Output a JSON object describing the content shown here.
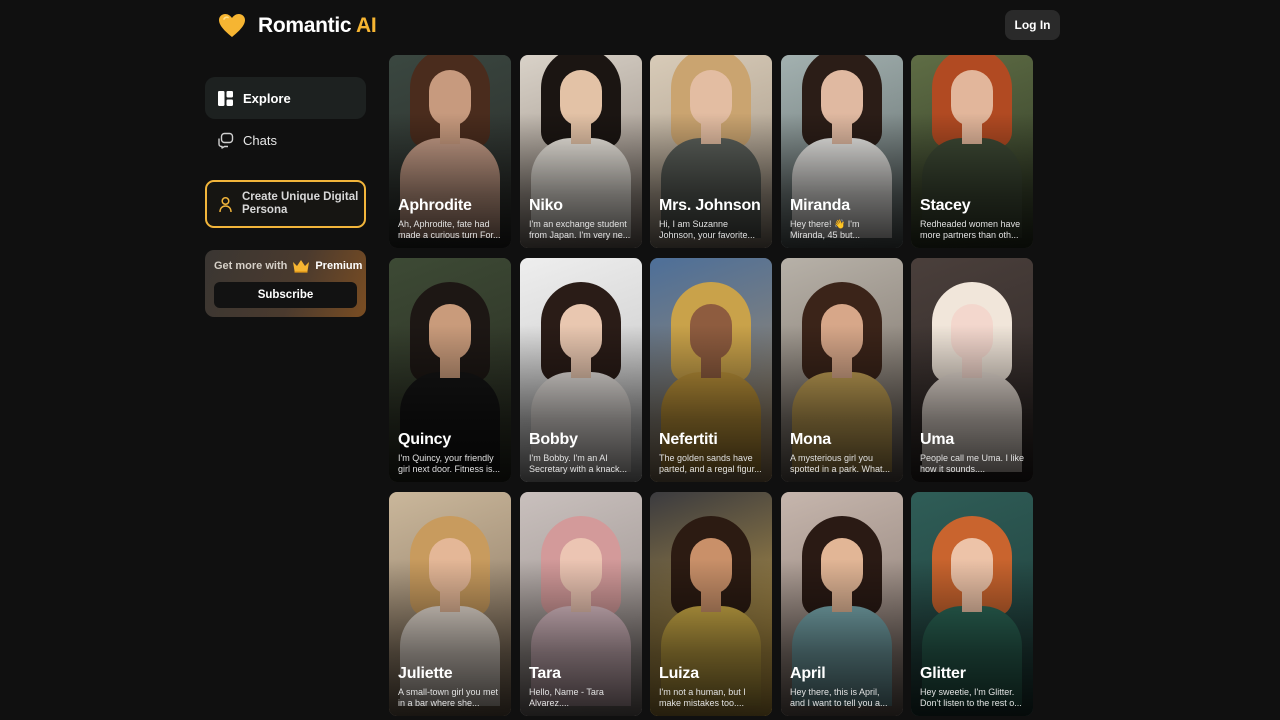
{
  "header": {
    "logo_text": "Romantic",
    "logo_accent": "AI",
    "login_label": "Log In"
  },
  "sidebar": {
    "explore_label": "Explore",
    "chats_label": "Chats",
    "create_label": "Create Unique Digital Persona",
    "premium_prefix": "Get more with",
    "premium_label": "Premium",
    "subscribe_label": "Subscribe"
  },
  "colors": {
    "accent": "#f6b532",
    "background": "#101010"
  },
  "icons": {
    "logo": "heart-icon",
    "explore": "grid-icon",
    "chats": "chat-bubbles-icon",
    "create": "person-icon",
    "premium": "crown-icon"
  },
  "characters": [
    {
      "name": "Aphrodite",
      "desc": "Ah, Aphrodite, fate had made a curious turn For..."
    },
    {
      "name": "Niko",
      "desc": "I'm an exchange student from Japan. I'm very ne..."
    },
    {
      "name": "Mrs. Johnson",
      "desc": "Hi, I am Suzanne Johnson, your favorite..."
    },
    {
      "name": "Miranda",
      "desc": "Hey there! 👋 I'm Miranda, 45 but..."
    },
    {
      "name": "Stacey",
      "desc": "Redheaded women have more partners than oth..."
    },
    {
      "name": "Quincy",
      "desc": "I'm Quincy, your friendly girl next door. Fitness is..."
    },
    {
      "name": "Bobby",
      "desc": "I'm Bobby. I'm an AI Secretary with a knack..."
    },
    {
      "name": "Nefertiti",
      "desc": "The golden sands have parted, and a regal figur..."
    },
    {
      "name": "Mona",
      "desc": "A mysterious girl you spotted in a park. What..."
    },
    {
      "name": "Uma",
      "desc": "People call me Uma. I like how it sounds...."
    },
    {
      "name": "Juliette",
      "desc": "A small-town girl you met in a bar where she..."
    },
    {
      "name": "Tara",
      "desc": "Hello, Name - Tara Alvarez...."
    },
    {
      "name": "Luiza",
      "desc": "I'm not a human, but I make mistakes too...."
    },
    {
      "name": "April",
      "desc": "Hey there, this is April, and I want to tell you a..."
    },
    {
      "name": "Glitter",
      "desc": "Hey sweetie, I'm Glitter. Don't listen to the rest o..."
    }
  ]
}
